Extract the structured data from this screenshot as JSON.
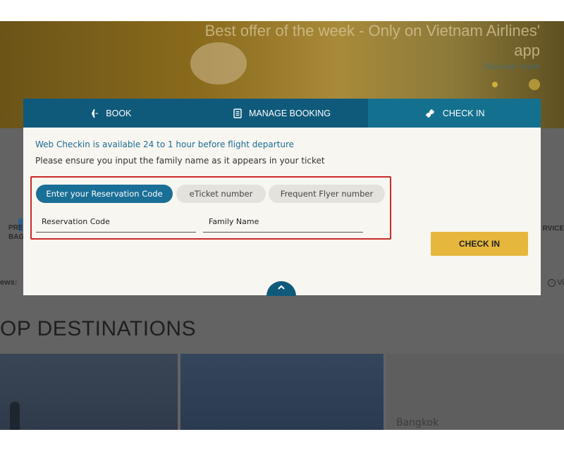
{
  "hero": {
    "title": "Best offer of the week - Only on Vietnam Airlines' app",
    "link": "Discover more"
  },
  "background": {
    "left_cut_1": "PRE",
    "left_cut_2": "BAG",
    "service_cut": "RVICE",
    "news_cut": "ews:",
    "view_cut": "Vi",
    "section_title": "OP DESTINATIONS",
    "dest_3_label": "Bangkok"
  },
  "tabs": [
    {
      "label": "BOOK",
      "icon": "airplane-icon"
    },
    {
      "label": "MANAGE BOOKING",
      "icon": "document-icon"
    },
    {
      "label": "CHECK IN",
      "icon": "ticket-icon",
      "active": true
    }
  ],
  "checkin": {
    "notice": "Web Checkin is available 24 to 1 hour before flight departure",
    "instruction": "Please ensure you input the family name as it appears in your ticket",
    "options": [
      {
        "label": "Enter your Reservation Code",
        "selected": true
      },
      {
        "label": "eTicket number",
        "selected": false
      },
      {
        "label": "Frequent Flyer number",
        "selected": false
      }
    ],
    "fields": {
      "reservation_placeholder": "Reservation Code",
      "family_placeholder": "Family Name"
    },
    "submit_label": "CHECK IN"
  },
  "colors": {
    "tab_bg": "#0f5a7b",
    "tab_active_bg": "#14708f",
    "primary_blue": "#1a6f97",
    "accent_yellow": "#e6b73d",
    "highlight_red": "#c92a2a"
  }
}
